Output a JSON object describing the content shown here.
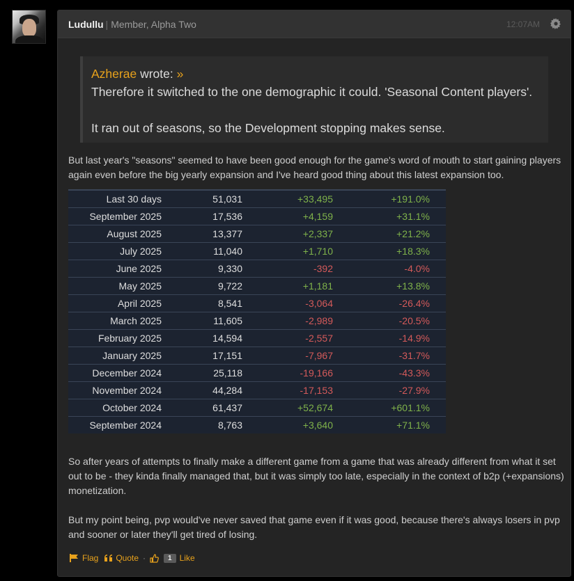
{
  "post": {
    "username": "Ludullu",
    "separator": "|",
    "rank": "Member, Alpha Two",
    "time": "12:07AM",
    "quote": {
      "author": "Azherae",
      "wrote": "wrote:",
      "jump": "»",
      "paragraphs": [
        "Therefore it switched to the one demographic it could. 'Seasonal Content players'.",
        "It ran out of seasons, so the Development stopping makes sense."
      ]
    },
    "intro_text": "But last year's \"seasons\" seemed to have been good enough for the game's word of mouth to start gaining players again even before the big yearly expansion and I've heard good thing about this latest expansion too.",
    "stats_rows": [
      {
        "month": "Last 30 days",
        "players": "51,031",
        "change": "+33,495",
        "pct": "+191.0%"
      },
      {
        "month": "September 2025",
        "players": "17,536",
        "change": "+4,159",
        "pct": "+31.1%"
      },
      {
        "month": "August 2025",
        "players": "13,377",
        "change": "+2,337",
        "pct": "+21.2%"
      },
      {
        "month": "July 2025",
        "players": "11,040",
        "change": "+1,710",
        "pct": "+18.3%"
      },
      {
        "month": "June 2025",
        "players": "9,330",
        "change": "-392",
        "pct": "-4.0%"
      },
      {
        "month": "May 2025",
        "players": "9,722",
        "change": "+1,181",
        "pct": "+13.8%"
      },
      {
        "month": "April 2025",
        "players": "8,541",
        "change": "-3,064",
        "pct": "-26.4%"
      },
      {
        "month": "March 2025",
        "players": "11,605",
        "change": "-2,989",
        "pct": "-20.5%"
      },
      {
        "month": "February 2025",
        "players": "14,594",
        "change": "-2,557",
        "pct": "-14.9%"
      },
      {
        "month": "January 2025",
        "players": "17,151",
        "change": "-7,967",
        "pct": "-31.7%"
      },
      {
        "month": "December 2024",
        "players": "25,118",
        "change": "-19,166",
        "pct": "-43.3%"
      },
      {
        "month": "November 2024",
        "players": "44,284",
        "change": "-17,153",
        "pct": "-27.9%"
      },
      {
        "month": "October 2024",
        "players": "61,437",
        "change": "+52,674",
        "pct": "+601.1%"
      },
      {
        "month": "September 2024",
        "players": "8,763",
        "change": "+3,640",
        "pct": "+71.1%"
      }
    ],
    "paragraph_2": "So after years of attempts to finally make a different game from a game that was already different from what it set out to be - they kinda finally managed that, but it was simply too late, especially in the context of b2p (+expansions) monetization.",
    "paragraph_3": "But my point being, pvp would've never saved that game even if it was good, because there's always losers in pvp and sooner or later they'll get tired of losing.",
    "actions": {
      "flag": "Flag",
      "quote": "Quote",
      "dot": "·",
      "like_count": "1",
      "like": "Like"
    }
  },
  "colors": {
    "accent": "#e8a21c",
    "positive": "#7fb24a",
    "negative": "#d45a5a",
    "table_bg": "#1c2330"
  },
  "icons": [
    "gear-icon",
    "flag-icon",
    "quote-icon",
    "thumbs-up-icon"
  ]
}
